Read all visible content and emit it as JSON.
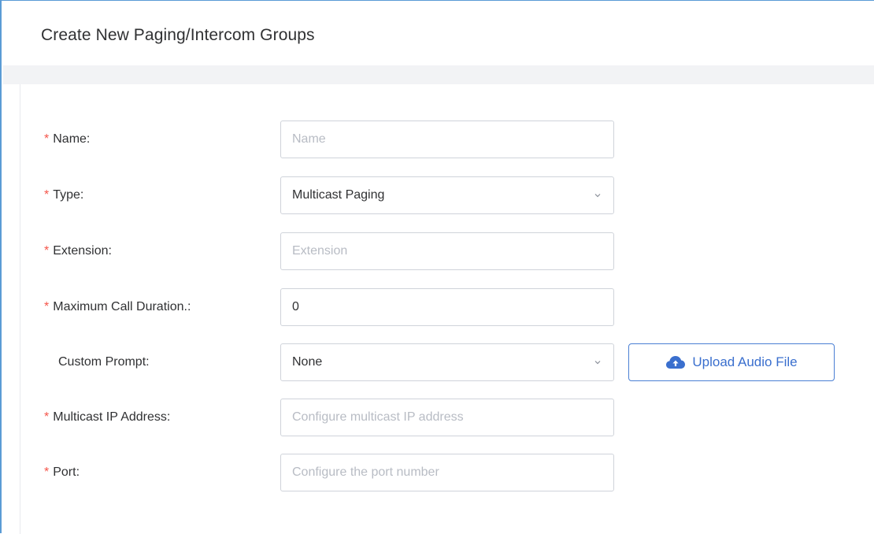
{
  "header": {
    "title": "Create New Paging/Intercom Groups"
  },
  "form": {
    "name": {
      "required": "*",
      "label": "Name:",
      "value": "",
      "placeholder": "Name"
    },
    "type": {
      "required": "*",
      "label": "Type:",
      "value": "Multicast Paging"
    },
    "extension": {
      "required": "*",
      "label": "Extension:",
      "value": "",
      "placeholder": "Extension"
    },
    "max_call_duration": {
      "required": "*",
      "label": "Maximum Call Duration.:",
      "value": "0",
      "placeholder": ""
    },
    "custom_prompt": {
      "label": "Custom Prompt:",
      "value": "None",
      "upload_button": {
        "icon": "cloud-upload-icon",
        "label": "Upload Audio File"
      }
    },
    "multicast_ip": {
      "required": "*",
      "label": "Multicast IP Address:",
      "value": "",
      "placeholder": "Configure multicast IP address"
    },
    "port": {
      "required": "*",
      "label": "Port:",
      "value": "",
      "placeholder": "Configure the port number"
    }
  },
  "colors": {
    "required_asterisk": "#f5554a",
    "accent": "#3a6fce",
    "frame_border": "#5a9bd5",
    "input_border": "#cfd3da",
    "placeholder": "#b8bcc4"
  }
}
